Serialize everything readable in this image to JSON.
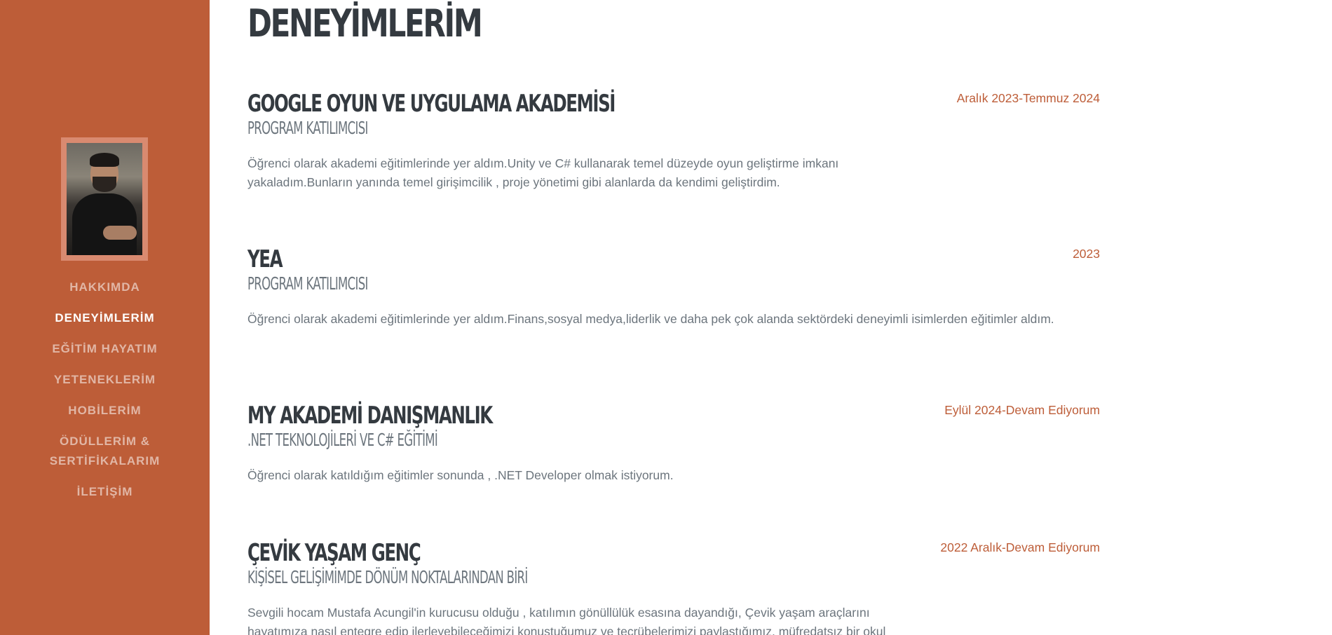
{
  "page_title": "DENEYİMLERİM",
  "nav": {
    "items": [
      {
        "label": "HAKKIMDA"
      },
      {
        "label": "DENEYİMLERİM"
      },
      {
        "label": "EĞİTİM HAYATIM"
      },
      {
        "label": "YETENEKLERİM"
      },
      {
        "label": "HOBİLERİM"
      },
      {
        "label": "ÖDÜLLERİM & SERTİFİKALARIM"
      },
      {
        "label": "İLETİŞİM"
      }
    ],
    "active_index": 1
  },
  "experiences": [
    {
      "title": "GOOGLE OYUN VE UYGULAMA AKADEMİSİ",
      "subtitle": "PROGRAM KATILIMCISI",
      "description": "Öğrenci olarak akademi eğitimlerinde yer aldım.Unity ve C# kullanarak temel düzeyde oyun geliştirme imkanı yakaladım.Bunların yanında temel girişimcilik , proje yönetimi gibi alanlarda da kendimi geliştirdim.",
      "date": "Aralık 2023-Temmuz 2024"
    },
    {
      "title": "YEA",
      "subtitle": "PROGRAM KATILIMCISI",
      "description": "Öğrenci olarak akademi eğitimlerinde yer aldım.Finans,sosyal medya,liderlik ve daha pek çok alanda sektördeki deneyimli isimlerden eğitimler aldım.",
      "date": "2023"
    },
    {
      "title": "MY AKADEMİ DANIŞMANLIK",
      "subtitle": ".NET TEKNOLOJİLERİ VE C# EĞİTİMİ",
      "description": "Öğrenci olarak katıldığım eğitimler sonunda , .NET Developer olmak istiyorum.",
      "date": "Eylül 2024-Devam Ediyorum"
    },
    {
      "title": "ÇEVİK YAŞAM GENÇ",
      "subtitle": "KİŞİSEL GELİŞİMİMDE DÖNÜM NOKTALARINDAN BİRİ",
      "description": "Sevgili hocam Mustafa Acungil'in kurucusu olduğu , katılımın gönüllülük esasına dayandığı, Çevik yaşam araçlarını hayatımıza nasıl entegre edip ilerleyebileceğimizi konuştuğumuz ve tecrübelerimizi paylaştığımız, müfredatsız bir okul",
      "date": "2022 Aralık-Devam Ediyorum"
    }
  ],
  "colors": {
    "sidebar_bg": "#bd5d38",
    "accent": "#bd5d38",
    "heading": "#343a40",
    "body_text": "#6c757d"
  }
}
